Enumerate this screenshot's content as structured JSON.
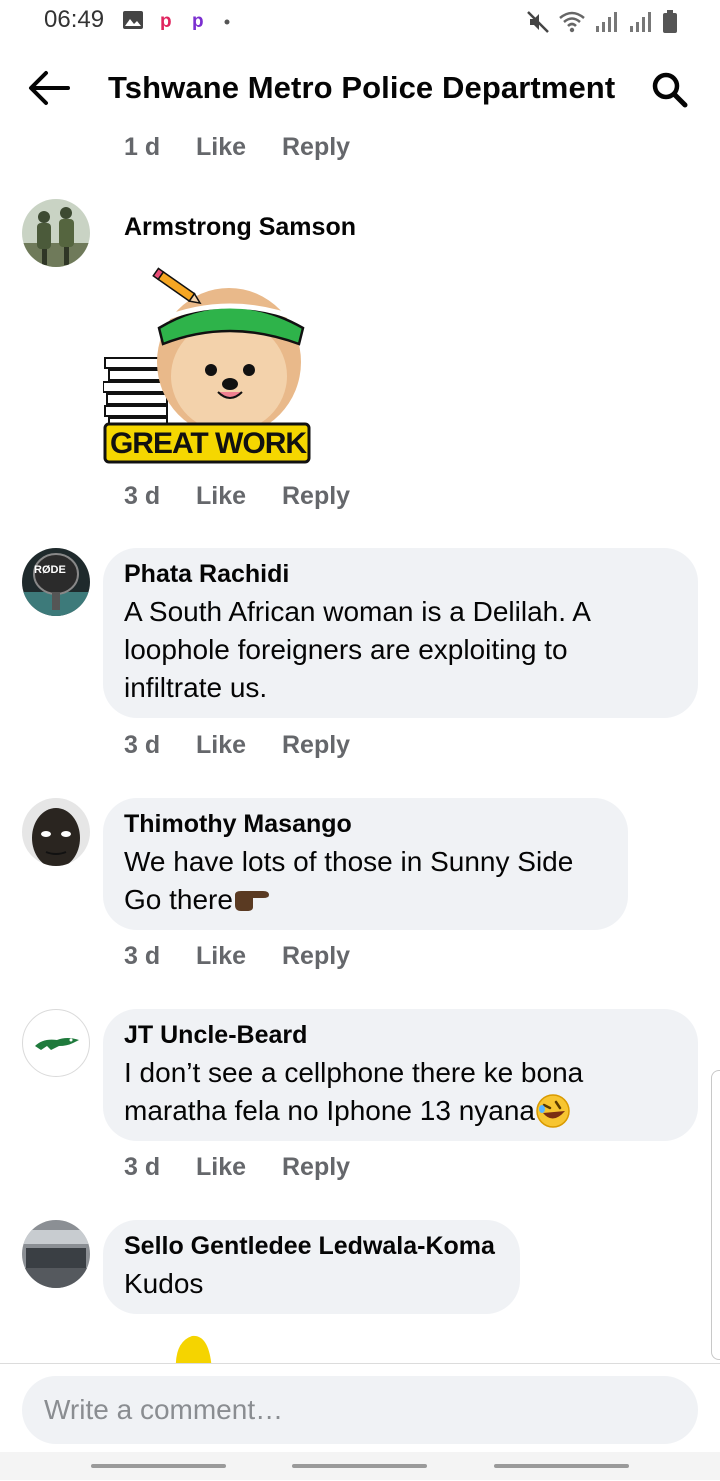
{
  "status": {
    "time": "06:49"
  },
  "header": {
    "title": "Tshwane Metro Police Department"
  },
  "actions": {
    "like": "Like",
    "reply": "Reply"
  },
  "comments": [
    {
      "time": "1 d"
    },
    {
      "author": "Armstrong Samson",
      "sticker_text": "GREAT WORK",
      "time": "3 d"
    },
    {
      "author": "Phata Rachidi",
      "text_lines": [
        "A South African woman is a Delilah. A",
        "loophole foreigners are exploiting to",
        "infiltrate us."
      ],
      "time": "3 d",
      "avatar_label": "RØDE"
    },
    {
      "author": "Thimothy Masango",
      "text_lines": [
        "We have lots of those in Sunny Side",
        "Go there"
      ],
      "time": "3 d"
    },
    {
      "author": "JT Uncle-Beard",
      "text_lines": [
        "I don’t see a cellphone there  ke bona",
        "maratha fela no Iphone 13 nyana"
      ],
      "time": "3 d"
    },
    {
      "author": "Sello Gentledee Ledwala-Koma",
      "text_lines": [
        "Kudos"
      ]
    }
  ],
  "composer": {
    "placeholder": "Write a comment…"
  },
  "colors": {
    "bubble": "#f0f2f5",
    "meta": "#65676b",
    "sticker_band": "#f5d700",
    "visor": "#2eb34a"
  }
}
